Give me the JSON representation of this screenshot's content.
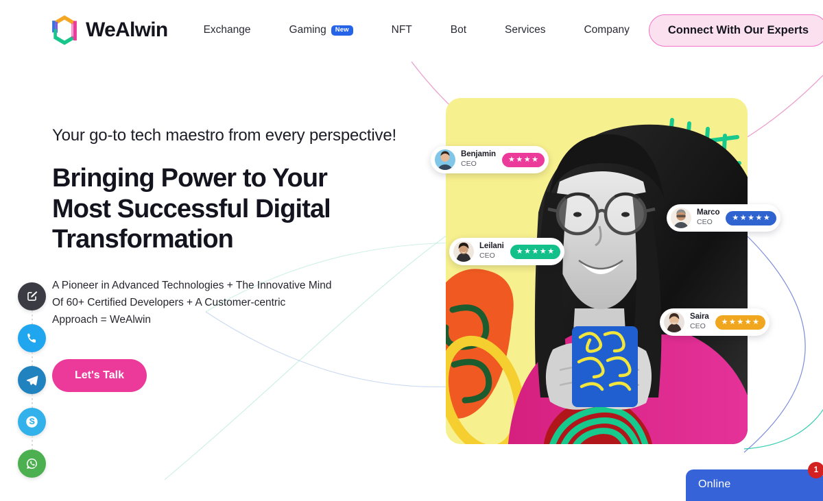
{
  "header": {
    "brand_name": "WeAlwin",
    "logo_icon": "hexagon-logo-icon",
    "nav": [
      {
        "label": "Exchange",
        "badge": ""
      },
      {
        "label": "Gaming",
        "badge": "New"
      },
      {
        "label": "NFT",
        "badge": ""
      },
      {
        "label": "Bot",
        "badge": ""
      },
      {
        "label": "Services",
        "badge": ""
      },
      {
        "label": "Company",
        "badge": ""
      }
    ],
    "cta_label": "Connect With Our Experts"
  },
  "social_rail": [
    {
      "name": "edit-icon",
      "title": "Write to us",
      "color": "#3b3b44"
    },
    {
      "name": "phone-icon",
      "title": "Call",
      "color": "#20a6ef"
    },
    {
      "name": "telegram-icon",
      "title": "Telegram",
      "color": "#2182c0"
    },
    {
      "name": "skype-icon",
      "title": "Skype",
      "color": "#32b1ea"
    },
    {
      "name": "whatsapp-icon",
      "title": "WhatsApp",
      "color": "#4caf50"
    }
  ],
  "hero": {
    "kicker": "Your go-to tech maestro from every perspective!",
    "headline": "Bringing Power to Your Most Successful Digital Transformation",
    "subcopy": "A Pioneer in Advanced Technologies + The Innovative Mind Of 60+ Certified Developers + A Customer-centric Approach = WeAlwin",
    "cta_label": "Let's Talk"
  },
  "testimonials": [
    {
      "id": "benjamin",
      "name": "Benjamin",
      "role": "CEO",
      "stars": 4,
      "pill_color": "#ec3a9b"
    },
    {
      "id": "leilani",
      "name": "Leilani",
      "role": "CEO",
      "stars": 5,
      "pill_color": "#14c08a"
    },
    {
      "id": "marco",
      "name": "Marco",
      "role": "CEO",
      "stars": 5,
      "pill_color": "#2f63cf"
    },
    {
      "id": "saira",
      "name": "Saira",
      "role": "CEO",
      "stars": 5,
      "pill_color": "#f0a71f"
    }
  ],
  "chat_widget": {
    "label": "Online",
    "badge_count": "1",
    "color": "#3763d8",
    "badge_color": "#d32020"
  },
  "theme": {
    "pink": "#ec3a9b",
    "pink_soft": "#fbe1ef",
    "blue": "#2563e9",
    "yellow_card": "#f7f08e",
    "text_dark": "#14141f"
  }
}
